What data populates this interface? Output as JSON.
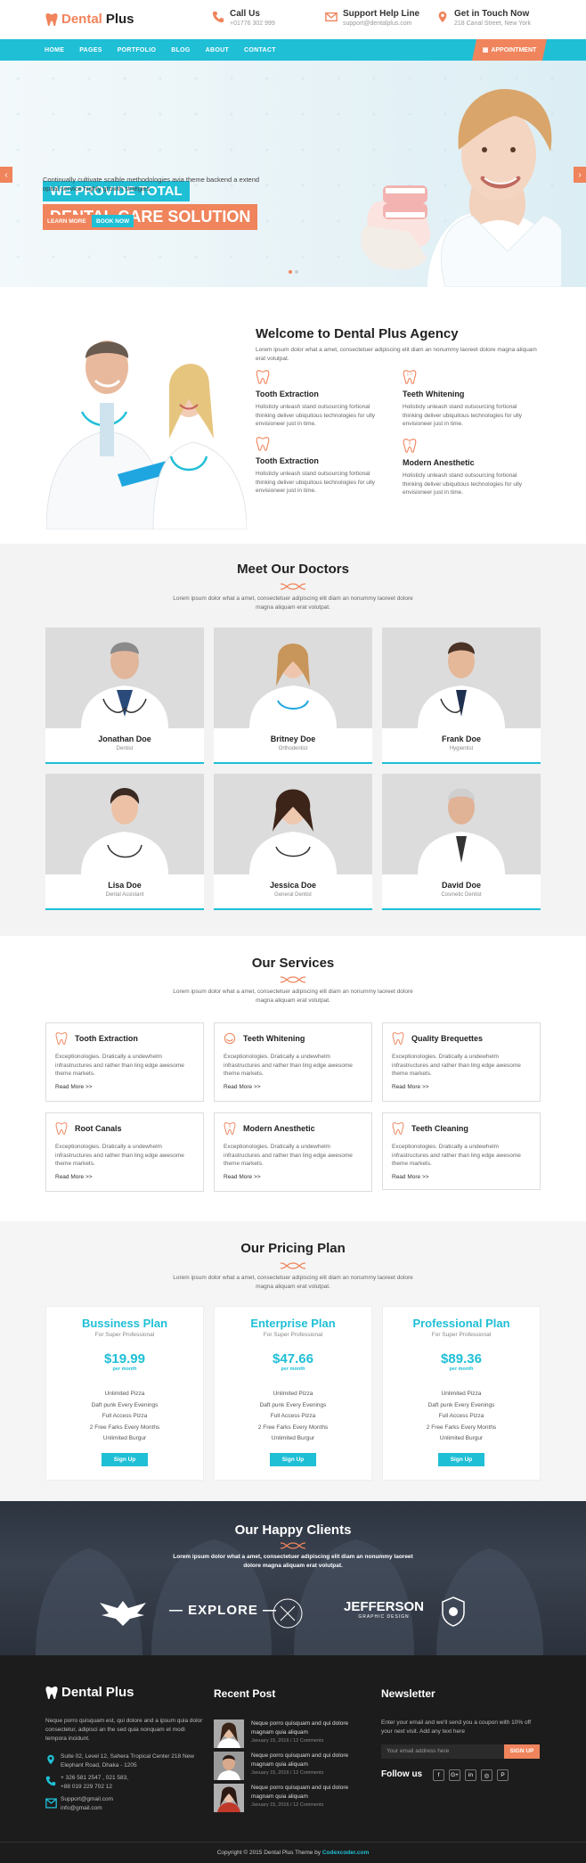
{
  "brand": {
    "name_part1": "Dental",
    "name_part2": " Plus"
  },
  "header": {
    "call_title": "Call Us",
    "call_sub": "+01776 302 999",
    "support_title": "Support Help Line",
    "support_sub": "support@dentalplus.com",
    "touch_title": "Get in Touch Now",
    "touch_sub": "218 Canal Street, New York"
  },
  "nav": {
    "items": [
      "HOME",
      "PAGES",
      "PORTFOLIO",
      "BLOG",
      "ABOUT",
      "CONTACT"
    ],
    "appointment": "APPOINTMENT"
  },
  "hero": {
    "tag1": "WE PROVIDE TOTAL",
    "tag2": "DENTAL CARE SOLUTION",
    "sub": "Continually cultivate scalble methodologies avia theme backend a extend optial service highly growth strtegies",
    "btn_learn": "LEARN MORE",
    "btn_book": "BOOK NOW",
    "prev": "‹",
    "next": "›"
  },
  "welcome": {
    "title": "Welcome to Dental Plus Agency",
    "sub": "Lorem ipsum dolor what a amet, consectetuer adipiscing elit diam an nonummy laoreet dolore magna aliquam erat volutpat.",
    "features": [
      {
        "title": "Tooth Extraction",
        "desc": "Holisticly unleash stand outsourcing fortional thinking deliver ubiquitous technologies for ully envisioneer just in time."
      },
      {
        "title": "Teeth Whitening",
        "desc": "Holisticly unleash stand outsourcing fortional thinking deliver ubiquitous technologies for ully envisioneer just in time."
      },
      {
        "title": "Tooth Extraction",
        "desc": "Holisticly unleash stand outsourcing fortional thinking deliver ubiquitous technologies for ully envisioneer just in time."
      },
      {
        "title": "Modern Anesthetic",
        "desc": "Holisticly unleash stand outsourcing fortional thinking deliver ubiquitous technologies for ully envisioneer just in time."
      }
    ]
  },
  "doctors": {
    "title": "Meet Our Doctors",
    "sub": "Lorem ipsum dolor what a amet, consectetuer adipiscing elit diam an nonummy laoreet dolore magna aliquam erat volutpat.",
    "items": [
      {
        "name": "Jonathan Doe",
        "role": "Dentist"
      },
      {
        "name": "Britney Doe",
        "role": "Orthodentist"
      },
      {
        "name": "Frank Doe",
        "role": "Hygientist"
      },
      {
        "name": "Lisa Doe",
        "role": "Dental Assistant"
      },
      {
        "name": "Jessica Doe",
        "role": "General Dentist"
      },
      {
        "name": "David Doe",
        "role": "Cosmetic Dentist"
      }
    ]
  },
  "services": {
    "title": "Our Services",
    "sub": "Lorem ipsum dolor what a amet, consectetuer adipiscing elit diam an nonummy laoreet dolore magna aliquam erat volutpat.",
    "items": [
      {
        "title": "Tooth Extraction",
        "desc": "Exceptionologies. Dratically a undewhelm infrastructures and rather than ling edge awesome theme markets.",
        "more": "Read More >>"
      },
      {
        "title": "Teeth Whitening",
        "desc": "Exceptionologies. Dratically a undewhelm infrastructures and rather than ling edge awesome theme markets.",
        "more": "Read More >>"
      },
      {
        "title": "Quality Brequettes",
        "desc": "Exceptionologies. Dratically a undewhelm infrastructures and rather than ling edge awesome theme markets.",
        "more": "Read More >>"
      },
      {
        "title": "Root Canals",
        "desc": "Exceptionologies. Dratically a undewhelm infrastructures and rather than ling edge awesome theme markets.",
        "more": "Read More >>"
      },
      {
        "title": "Modern Anesthetic",
        "desc": "Exceptionologies. Dratically a undewhelm infrastructures and rather than ling edge awesome theme markets.",
        "more": "Read More >>"
      },
      {
        "title": "Teeth Cleaning",
        "desc": "Exceptionologies. Dratically a undewhelm infrastructures and rather than ling edge awesome theme markets.",
        "more": "Read More >>"
      }
    ]
  },
  "pricing": {
    "title": "Our Pricing Plan",
    "sub": "Lorem ipsum dolor what a amet, consectetuer adipiscing elit diam an nonummy laoreet dolore magna aliquam erat volutpat.",
    "plans": [
      {
        "name": "Bussiness Plan",
        "sub": "For Super Professional",
        "price": "$19.99",
        "per": "per month",
        "f1": "Unlimited Pizza",
        "f2": "Daft punk Every Evenings",
        "f3": "Full Access Pizza",
        "f4": "2 Free Farks Every Months",
        "f5": "Unlimited Burgur",
        "btn": "Sign Up"
      },
      {
        "name": "Enterprise Plan",
        "sub": "For Super Professional",
        "price": "$47.66",
        "per": "per month",
        "f1": "Unlimited Pizza",
        "f2": "Daft punk Every Evenings",
        "f3": "Full Access Pizza",
        "f4": "2 Free Farks Every Months",
        "f5": "Unlimited Burgur",
        "btn": "Sign Up"
      },
      {
        "name": "Professional Plan",
        "sub": "For Super Professional",
        "price": "$89.36",
        "per": "per month",
        "f1": "Unlimited Pizza",
        "f2": "Daft punk Every Evenings",
        "f3": "Full Access Pizza",
        "f4": "2 Free Farks Every Months",
        "f5": "Unlimited Burgur",
        "btn": "Sign Up"
      }
    ]
  },
  "clients": {
    "title": "Our Happy Clients",
    "sub": "Lorem ipsum dolor what a amet, consectetuer adipiscing elit diam an nonummy laoreet dolore magna aliquam erat volutpat.",
    "logos": [
      "EXPLORE",
      "JEFFERSON",
      "GRAPHIC DESIGN"
    ]
  },
  "footer": {
    "about": "Neque porro quisquam est, qui dolore and a ipsum quia dolor consectetur, adipisci an the sed quia nonquam et modi tempora incidunt.",
    "address": "Suite 02, Level 12, Sahera Tropical Center 218 New Elephant Road, Dhaka - 1205",
    "phone1": "+ 326 581 2547 , 021 583,",
    "phone2": "+88 019 229 702 12",
    "email1": "Support@gmail.com",
    "email2": "info@gmail.com",
    "recent_title": "Recent Post",
    "posts": [
      {
        "title": "Neque porro quisquam and qui dolore magnam quia aliquam",
        "meta": "January 15, 2016 / 12 Comments"
      },
      {
        "title": "Neque porro quisquam and qui dolore magnam quia aliquam",
        "meta": "January 15, 2016 / 12 Comments"
      },
      {
        "title": "Neque porro quisquam and qui dolore magnam quia aliquam",
        "meta": "January 15, 2016 / 12 Comments"
      }
    ],
    "news_title": "Newsletter",
    "news_text": "Enter your email and we'll send you a coupon with 10% off your next visit. Add any text here",
    "email_placeholder": "Your email address here",
    "signup": "SIGN UP",
    "follow": "Follow us",
    "social": [
      "f",
      "G+",
      "in",
      "◎",
      "P"
    ],
    "copyright": "Copyright © 2015 Dental Plus Theme by ",
    "copyright_link": "Codexcoder.com"
  }
}
